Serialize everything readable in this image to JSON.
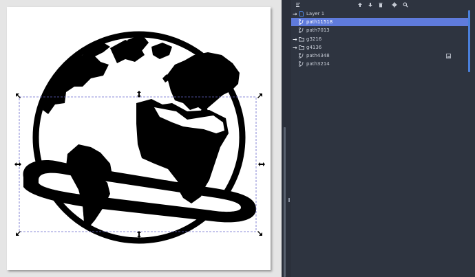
{
  "canvas": {
    "page_color": "#ffffff",
    "desk_color": "#e5e5e5",
    "drawing": "globe-with-orbit-ring"
  },
  "layers_panel": {
    "toolbar": {
      "buttons": [
        {
          "name": "menu",
          "icon": "hamburger-icon"
        },
        {
          "name": "raise",
          "icon": "arrow-up-icon"
        },
        {
          "name": "lower",
          "icon": "arrow-down-icon"
        },
        {
          "name": "delete",
          "icon": "trash-icon"
        },
        {
          "name": "settings",
          "icon": "gear-icon"
        },
        {
          "name": "search",
          "icon": "search-icon"
        }
      ]
    },
    "items": [
      {
        "label": "Layer 1",
        "type": "layer",
        "expandable": true,
        "selected": false
      },
      {
        "label": "path11518",
        "type": "path",
        "expandable": false,
        "selected": true
      },
      {
        "label": "path7013",
        "type": "path",
        "expandable": false,
        "selected": false
      },
      {
        "label": "g3216",
        "type": "group",
        "expandable": true,
        "selected": false
      },
      {
        "label": "g4136",
        "type": "group",
        "expandable": true,
        "selected": false
      },
      {
        "label": "path4348",
        "type": "path",
        "expandable": false,
        "selected": false,
        "badge": "image-icon"
      },
      {
        "label": "path3214",
        "type": "path",
        "expandable": false,
        "selected": false
      }
    ],
    "colors": {
      "panel_bg": "#2e3440",
      "selection": "#5f7bdc",
      "text": "#c7ccd6",
      "accent_scroll": "#4a80dc"
    }
  }
}
